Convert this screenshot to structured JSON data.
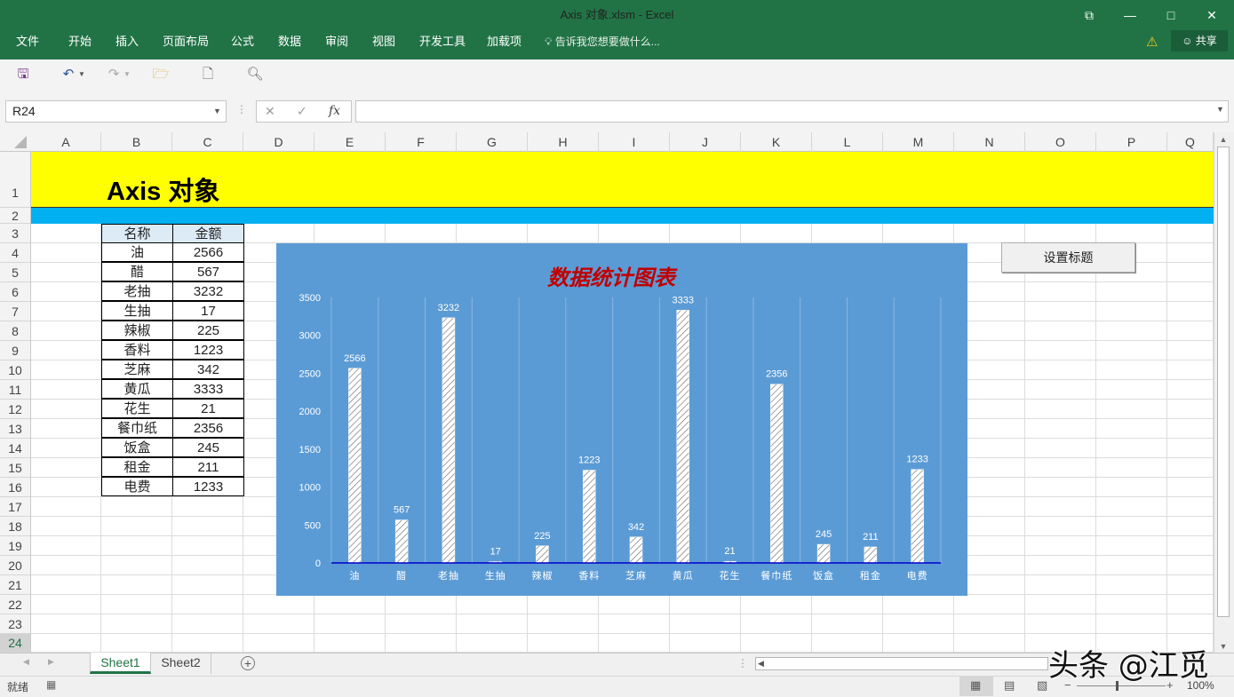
{
  "window": {
    "title": "Axis 对象.xlsm - Excel",
    "restore_icon": "restore-icon",
    "minimize_icon": "minimize-icon",
    "maximize_icon": "maximize-icon",
    "close_icon": "close-icon"
  },
  "ribbon": {
    "tabs": [
      "文件",
      "开始",
      "插入",
      "页面布局",
      "公式",
      "数据",
      "审阅",
      "视图",
      "开发工具",
      "加载项"
    ],
    "tell_me": "告诉我您想要做什么...",
    "share": "共享",
    "colors": {
      "ribbon": "#217346",
      "accent": "#217346"
    }
  },
  "formula_bar": {
    "name_box": "R24",
    "fx_label": "fx",
    "formula": ""
  },
  "columns": [
    "A",
    "B",
    "C",
    "D",
    "E",
    "F",
    "G",
    "H",
    "I",
    "J",
    "K",
    "L",
    "M",
    "N",
    "O",
    "P",
    "Q"
  ],
  "rows": [
    "1",
    "2",
    "3",
    "4",
    "5",
    "6",
    "7",
    "8",
    "9",
    "10",
    "11",
    "12",
    "13",
    "14",
    "15",
    "16",
    "17",
    "18",
    "19",
    "20",
    "21",
    "22",
    "23",
    "24"
  ],
  "sheet": {
    "title": "Axis 对象",
    "title_band_color": "#ffff00",
    "subband_color": "#00b0f0",
    "table": {
      "headers": [
        "名称",
        "金额"
      ],
      "rows": [
        [
          "油",
          "2566"
        ],
        [
          "醋",
          "567"
        ],
        [
          "老抽",
          "3232"
        ],
        [
          "生抽",
          "17"
        ],
        [
          "辣椒",
          "225"
        ],
        [
          "香料",
          "1223"
        ],
        [
          "芝麻",
          "342"
        ],
        [
          "黄瓜",
          "3333"
        ],
        [
          "花生",
          "21"
        ],
        [
          "餐巾纸",
          "2356"
        ],
        [
          "饭盒",
          "245"
        ],
        [
          "租金",
          "211"
        ],
        [
          "电费",
          "1233"
        ]
      ]
    },
    "button_label": "设置标题"
  },
  "chart_data": {
    "type": "bar",
    "title": "数据统计图表",
    "categories": [
      "油",
      "醋",
      "老抽",
      "生抽",
      "辣椒",
      "香料",
      "芝麻",
      "黄瓜",
      "花生",
      "餐巾纸",
      "饭盒",
      "租金",
      "电费"
    ],
    "values": [
      2566,
      567,
      3232,
      17,
      225,
      1223,
      342,
      3333,
      21,
      2356,
      245,
      211,
      1233
    ],
    "ylim": [
      0,
      3500
    ],
    "yticks": [
      0,
      500,
      1000,
      1500,
      2000,
      2500,
      3000,
      3500
    ],
    "grid": "vertical",
    "data_labels": true,
    "colors": {
      "background": "#5b9bd5",
      "title": "#c00000",
      "axis_line": "#0000cc",
      "bar_fill": "#ffffff",
      "bar_hatch": "#6e6e6e"
    }
  },
  "sheet_tabs": [
    "Sheet1",
    "Sheet2"
  ],
  "active_sheet": "Sheet1",
  "status": {
    "ready": "就绪",
    "zoom": "100%"
  },
  "watermark": "头条 @江觅"
}
